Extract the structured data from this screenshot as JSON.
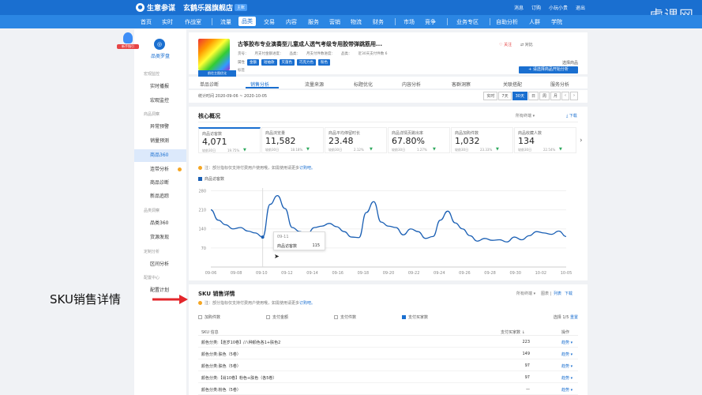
{
  "topbar": {
    "brand": "生意参谋",
    "shop": "玄鹤乐器旗舰店",
    "shop_tag": "主账",
    "links": [
      "消息",
      "订购",
      "小玩小贵",
      "退出"
    ],
    "watermark": "虎课网"
  },
  "nav": [
    "首页",
    "实时",
    "作战室",
    "流量",
    "品类",
    "交易",
    "内容",
    "服务",
    "营销",
    "物流",
    "财务",
    "市场",
    "竞争",
    "业务专区",
    "自助分析",
    "人群",
    "学院"
  ],
  "nav_active": "品类",
  "sidebar": {
    "badge": "新手指引",
    "title": "品类罗盘",
    "groups": [
      {
        "label": "宏观监控",
        "items": [
          "实时播报",
          "宏观监控"
        ]
      },
      {
        "label": "商品洞察",
        "items": [
          "异常预警",
          "销量预测",
          "商品360",
          "连带分析",
          "商品诊断",
          "新品追踪"
        ]
      },
      {
        "label": "品类洞察",
        "items": [
          "品类360",
          "货源发现"
        ]
      },
      {
        "label": "定制分析",
        "items": [
          "区间分析"
        ]
      },
      {
        "label": "配置中心",
        "items": [
          "配置计划"
        ]
      }
    ],
    "active": "商品360"
  },
  "product": {
    "title": "古筝胶布专业演奏型儿童成人透气考级专用胶带弹跳筋用...",
    "image_button": "前往主图优化",
    "meta": [
      "货号：",
      "月支付金额进度：",
      "品类：",
      "月支付件数进度：",
      "品类：",
      "近30天支付件数 6"
    ],
    "attr_label": "属性",
    "attrs": [
      "金额",
      "短袖款",
      "灭菌色",
      "巧克力色",
      "粉色"
    ],
    "attr2": "标签",
    "follow": "♡ 关注",
    "compare": "⇄ 对比",
    "select_label": "选择商品",
    "add_button": "+ 请选择商品开始分析"
  },
  "tabs": [
    "单品诊断",
    "销售分析",
    "流量来源",
    "标题优化",
    "内容分析",
    "客群洞察",
    "关联搭配",
    "服务分析"
  ],
  "tab_active": "销售分析",
  "date": {
    "text": "统计时间 2020-09-06 ~ 2020-10-05",
    "buttons": [
      "实时",
      "7天",
      "30天",
      "日",
      "周",
      "月",
      "‹",
      "›"
    ],
    "active": "30天"
  },
  "core": {
    "title": "核心概况",
    "right_links": [
      "所有终端 ▾",
      "⤓ 下载"
    ],
    "kpis": [
      {
        "label": "商品访客数",
        "value": "4,071",
        "cmp": "较前30日",
        "pct": "19.75%",
        "arrow": "▼"
      },
      {
        "label": "商品浏览量",
        "value": "11,582",
        "cmp": "较前30日",
        "pct": "18.18%",
        "arrow": "▼"
      },
      {
        "label": "商品平均停留时长",
        "value": "23.48",
        "cmp": "较前30日",
        "pct": "2.12%",
        "arrow": "▼"
      },
      {
        "label": "商品详情页跳出率",
        "value": "67.80%",
        "cmp": "较前30日",
        "pct": "1.27%",
        "arrow": "▼"
      },
      {
        "label": "商品加购件数",
        "value": "1,032",
        "cmp": "较前30日",
        "pct": "23.33%",
        "arrow": "▼"
      },
      {
        "label": "商品收藏人数",
        "value": "134",
        "cmp": "较前30日",
        "pct": "22.54%",
        "arrow": "▼"
      }
    ],
    "note": "注：部分指标仅支持付费用户使用哦，如需使用请更多",
    "note_link": "订购吧。"
  },
  "chart_data": {
    "type": "line",
    "series": [
      {
        "name": "商品访客数",
        "values": [
          210,
          172,
          155,
          140,
          145,
          132,
          125,
          110,
          230,
          262,
          215,
          145,
          130,
          120,
          145,
          150,
          160,
          148,
          130,
          110,
          108,
          200,
          240,
          165,
          150,
          145,
          118,
          140,
          130,
          105,
          112,
          172,
          205,
          162,
          140,
          115,
          95,
          105,
          98,
          100,
          92,
          110,
          100,
          115,
          130,
          125,
          120,
          132,
          112
        ]
      },
      {
        "name": "",
        "values": []
      }
    ],
    "x": [
      "09-06",
      "09-08",
      "09-10",
      "09-12",
      "09-14",
      "09-16",
      "09-18",
      "09-20",
      "09-22",
      "09-24",
      "09-26",
      "09-28",
      "09-30",
      "10-02",
      "10-05"
    ],
    "y_ticks": [
      70,
      140,
      210,
      280
    ],
    "ylim": [
      0,
      290
    ],
    "tooltip": {
      "date": "09-11",
      "label": "商品访客数",
      "value": "115"
    }
  },
  "sku": {
    "title": "SKU 销售详情",
    "right_links": [
      "所有终端 ▾",
      "图表 |",
      "列表",
      "下载"
    ],
    "note": "注：部分指标仅支持付费用户使用哦，如需使用请更多",
    "note_link": "订购吧。",
    "checks": [
      {
        "label": "加购件数",
        "on": false
      },
      {
        "label": "支付金额",
        "on": false
      },
      {
        "label": "支付件数",
        "on": false
      },
      {
        "label": "支付买家数",
        "on": true
      }
    ],
    "selected": "选择 1/5",
    "reset": "重置",
    "headers": [
      "SKU 信息",
      "支付买家数 ↓",
      "操作"
    ],
    "rows": [
      {
        "name": "颜色分类:【连岁10卷】/八种颜色各1+肤色2",
        "value": "223",
        "op": "趋势 ▾"
      },
      {
        "name": "颜色分类:肤色（5卷）",
        "value": "149",
        "op": "趋势 ▾"
      },
      {
        "name": "颜色分类:肤色（5卷）",
        "value": "97",
        "op": "趋势 ▾"
      },
      {
        "name": "颜色分类:【肖10卷】粉色+肤色（各5卷）",
        "value": "97",
        "op": "趋势 ▾"
      },
      {
        "name": "颜色分类:粉色（5卷）",
        "value": "—",
        "op": "趋势 ▾"
      }
    ]
  },
  "annotation": "SKU销售详情"
}
